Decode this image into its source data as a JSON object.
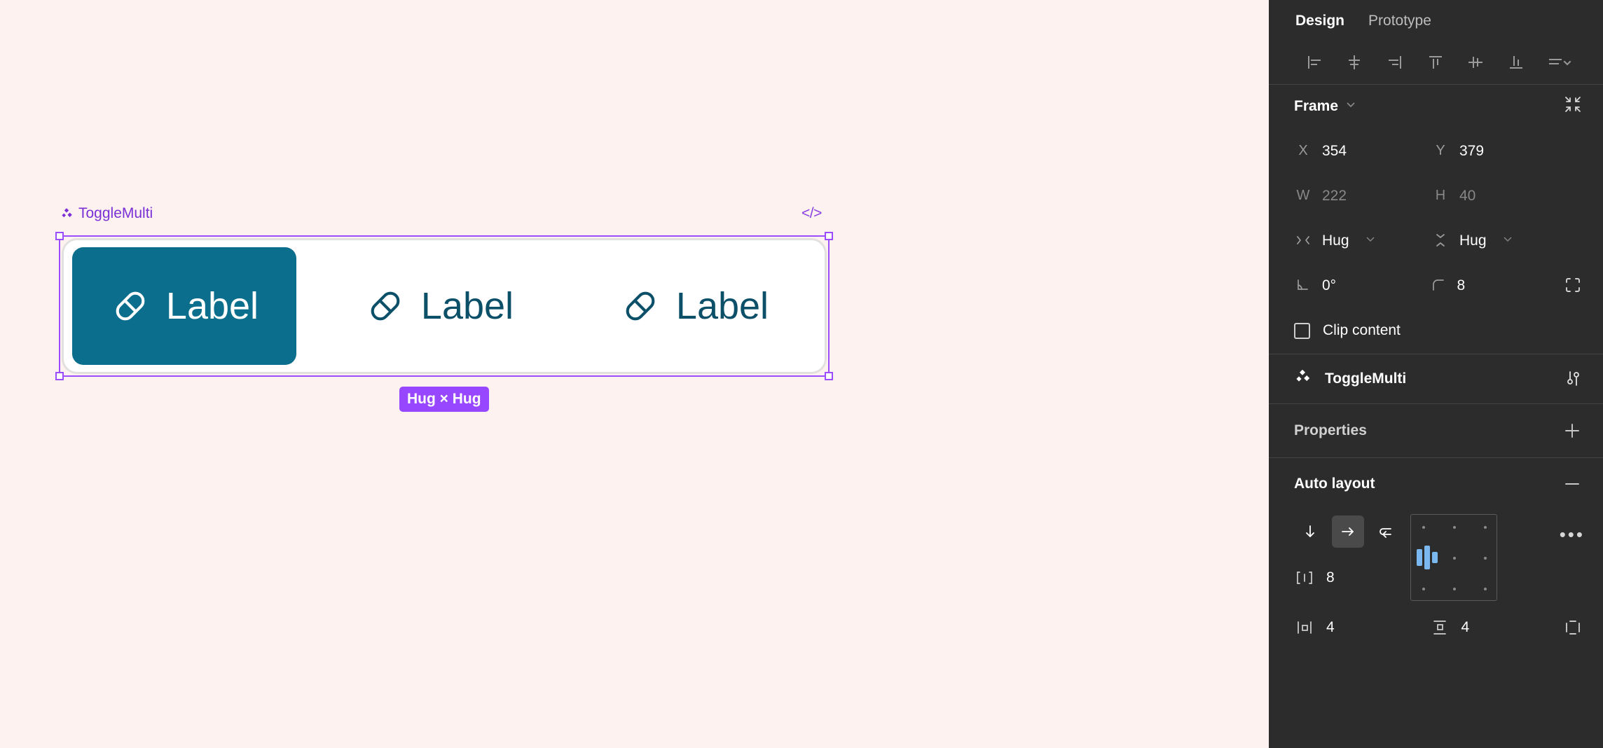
{
  "canvas": {
    "background_color": "#FDF2F0",
    "node_name": "ToggleMulti",
    "node_icon": "component-diamond-icon",
    "code_icon": "</>",
    "size_badge": "Hug × Hug",
    "selection_color": "#9B4DFF",
    "badge_color": "#9747FF",
    "component": {
      "track_background": "#FFFFFF",
      "track_border": "#E3E1E0",
      "selected_color": "#0B6E8C",
      "unselected_text_color": "#0B5068",
      "items": [
        {
          "label": "Label",
          "icon": "pill-icon",
          "state": "selected"
        },
        {
          "label": "Label",
          "icon": "pill-icon",
          "state": "unselected"
        },
        {
          "label": "Label",
          "icon": "pill-icon",
          "state": "unselected"
        }
      ]
    }
  },
  "panel": {
    "background_color": "#2C2C2C",
    "tabs": [
      {
        "label": "Design",
        "active": true
      },
      {
        "label": "Prototype",
        "active": false
      }
    ],
    "align_tools": [
      {
        "name": "align-left-icon"
      },
      {
        "name": "align-horizontal-center-icon"
      },
      {
        "name": "align-right-icon"
      },
      {
        "name": "align-top-icon"
      },
      {
        "name": "align-vertical-center-icon"
      },
      {
        "name": "align-bottom-icon"
      },
      {
        "name": "distribute-menu-icon"
      }
    ],
    "frame": {
      "title": "Frame",
      "collapse_icon": "chevron-down-icon",
      "expand_icon": "collapse-arrows-icon",
      "x_label": "X",
      "x_value": "354",
      "y_label": "Y",
      "y_value": "379",
      "w_label": "W",
      "w_value": "222",
      "h_label": "H",
      "h_value": "40",
      "hug_width_icon": "horizontal-resizing-icon",
      "hug_width_value": "Hug",
      "hug_height_icon": "vertical-resizing-icon",
      "hug_height_value": "Hug",
      "rotation_icon": "rotation-icon",
      "rotation_value": "0°",
      "corner_icon": "corner-radius-icon",
      "corner_value": "8",
      "independent_corners_icon": "independent-corners-icon",
      "clip_content_label": "Clip content",
      "clip_content_checked": false
    },
    "component": {
      "icon": "component-diamond-icon",
      "name": "ToggleMulti",
      "actions_icon": "variant-sliders-icon"
    },
    "properties": {
      "title": "Properties",
      "add_icon": "plus-icon"
    },
    "auto_layout": {
      "title": "Auto layout",
      "remove_icon": "minus-icon",
      "directions": [
        {
          "name": "direction-vertical-icon",
          "active": false
        },
        {
          "name": "direction-horizontal-icon",
          "active": true
        },
        {
          "name": "direction-wrap-icon",
          "active": false
        }
      ],
      "gap_icon": "gap-spacing-icon",
      "gap_value": "8",
      "horizontal_padding_icon": "horizontal-padding-icon",
      "horizontal_padding_value": "4",
      "vertical_padding_icon": "vertical-padding-icon",
      "vertical_padding_value": "4",
      "individual_padding_icon": "individual-padding-icon",
      "more_icon": "more-options-icon",
      "alignment_grid_icon": "alignment-grid-picker"
    }
  }
}
